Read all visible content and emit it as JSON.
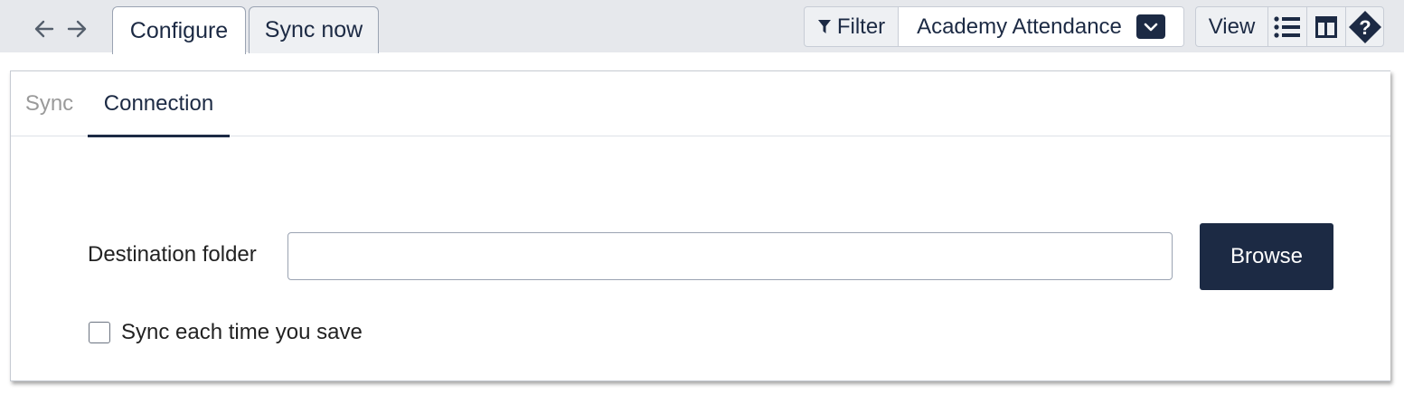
{
  "toolbar": {
    "back_icon": "arrow-left-icon",
    "forward_icon": "arrow-right-icon",
    "tabs": [
      {
        "label": "Configure",
        "active": true
      },
      {
        "label": "Sync now",
        "active": false
      }
    ],
    "filter_label": "Filter",
    "filter_icon": "funnel-icon",
    "dataset_selected": "Academy Attendance",
    "dropdown_icon": "chevron-down-icon",
    "view_label": "View",
    "list_icon": "list-icon",
    "layout_icon": "layout-icon",
    "help_icon": "help-diamond-icon"
  },
  "panel": {
    "subtabs": [
      {
        "label": "Sync",
        "active": false
      },
      {
        "label": "Connection",
        "active": true
      }
    ],
    "destination_label": "Destination folder",
    "destination_value": "",
    "browse_label": "Browse",
    "sync_on_save_label": "Sync each time you save",
    "sync_on_save_checked": false
  },
  "colors": {
    "navy": "#1c2a44",
    "toolbar_bg": "#e6e8ec",
    "muted_text": "#9a9a9a"
  }
}
